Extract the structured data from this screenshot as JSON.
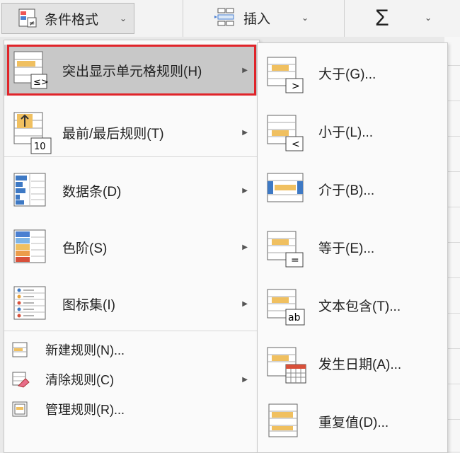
{
  "ribbon": {
    "conditional_format_label": "条件格式",
    "insert_label": "插入",
    "sum_symbol": "Σ"
  },
  "main_menu": {
    "items": [
      {
        "label": "突出显示单元格规则(H)",
        "icon": "highlight-cells-icon",
        "has_submenu": true,
        "highlighted": true
      },
      {
        "label": "最前/最后规则(T)",
        "icon": "top-bottom-icon",
        "has_submenu": true
      },
      {
        "label": "数据条(D)",
        "icon": "data-bars-icon",
        "has_submenu": true
      },
      {
        "label": "色阶(S)",
        "icon": "color-scales-icon",
        "has_submenu": true
      },
      {
        "label": "图标集(I)",
        "icon": "icon-sets-icon",
        "has_submenu": true
      },
      {
        "label": "新建规则(N)...",
        "icon": "new-rule-icon",
        "has_submenu": false
      },
      {
        "label": "清除规则(C)",
        "icon": "clear-rules-icon",
        "has_submenu": true
      },
      {
        "label": "管理规则(R)...",
        "icon": "manage-rules-icon",
        "has_submenu": false
      }
    ],
    "top_bottom_badge": "10"
  },
  "sub_menu": {
    "items": [
      {
        "label": "大于(G)...",
        "icon": "greater-than-icon",
        "badge": ">"
      },
      {
        "label": "小于(L)...",
        "icon": "less-than-icon",
        "badge": "<"
      },
      {
        "label": "介于(B)...",
        "icon": "between-icon",
        "badge": ""
      },
      {
        "label": "等于(E)...",
        "icon": "equal-to-icon",
        "badge": "="
      },
      {
        "label": "文本包含(T)...",
        "icon": "text-contains-icon",
        "badge": "ab"
      },
      {
        "label": "发生日期(A)...",
        "icon": "date-occurring-icon",
        "badge": ""
      },
      {
        "label": "重复值(D)...",
        "icon": "duplicate-values-icon",
        "badge": ""
      }
    ]
  },
  "colors": {
    "highlight_border": "#e0242a",
    "highlight_bg": "#c8c8c8",
    "cell_yellow": "#f0c060",
    "databar_blue": "#3e79c4"
  }
}
